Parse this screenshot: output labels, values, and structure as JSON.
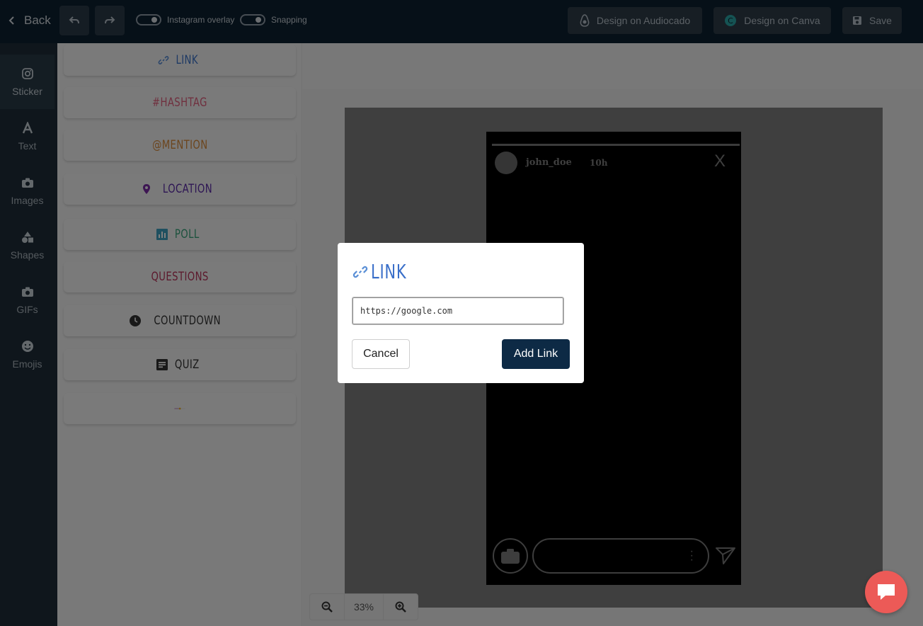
{
  "topbar": {
    "back_label": "Back",
    "toggles": [
      {
        "label": "Instagram overlay"
      },
      {
        "label": "Snapping"
      }
    ],
    "actions": [
      {
        "label": "Design on Audiocado",
        "icon": "avocado-icon"
      },
      {
        "label": "Design on Canva",
        "icon": "canva-icon"
      },
      {
        "label": "Save",
        "icon": "floppy-disk-icon"
      }
    ]
  },
  "leftnav": {
    "items": [
      {
        "label": "Sticker",
        "icon": "instagram-icon",
        "active": true
      },
      {
        "label": "Text",
        "icon": "text-icon"
      },
      {
        "label": "Images",
        "icon": "camera-icon"
      },
      {
        "label": "Shapes",
        "icon": "shapes-icon"
      },
      {
        "label": "GIFs",
        "icon": "camera-icon"
      },
      {
        "label": "Emojis",
        "icon": "smile-icon"
      }
    ]
  },
  "stickers": [
    {
      "label": "LINK",
      "icon": "link-icon",
      "color": "#3b72c9"
    },
    {
      "label": "#HASHTAG",
      "color": "#e0607e"
    },
    {
      "label": "@MENTION",
      "color": "#d88a3a"
    },
    {
      "label": "LOCATION",
      "icon": "map-pin-icon",
      "color": "#7a2ba7"
    },
    {
      "label": "POLL",
      "icon": "poll-icon",
      "color": "#37a37a"
    },
    {
      "label": "QUESTIONS",
      "color": "#b8335a"
    },
    {
      "label": "COUNTDOWN",
      "icon": "clock-icon",
      "color": "#333333"
    },
    {
      "label": "QUIZ",
      "icon": "quiz-icon",
      "color": "#333333"
    },
    {
      "label": "",
      "icon": "emoji-slider-icon",
      "slider_fraction": 0.5
    }
  ],
  "story": {
    "username": "john_doe",
    "time": "10h",
    "close_label": "X"
  },
  "zoom": {
    "value": "33%"
  },
  "modal": {
    "title": "LINK",
    "input_value": "https://google.com",
    "cancel_label": "Cancel",
    "add_label": "Add Link"
  },
  "colors": {
    "topbar": "#0d2030",
    "nav": "#1e2d39",
    "accent": "#0d2a45",
    "chat": "#ec5a57"
  }
}
